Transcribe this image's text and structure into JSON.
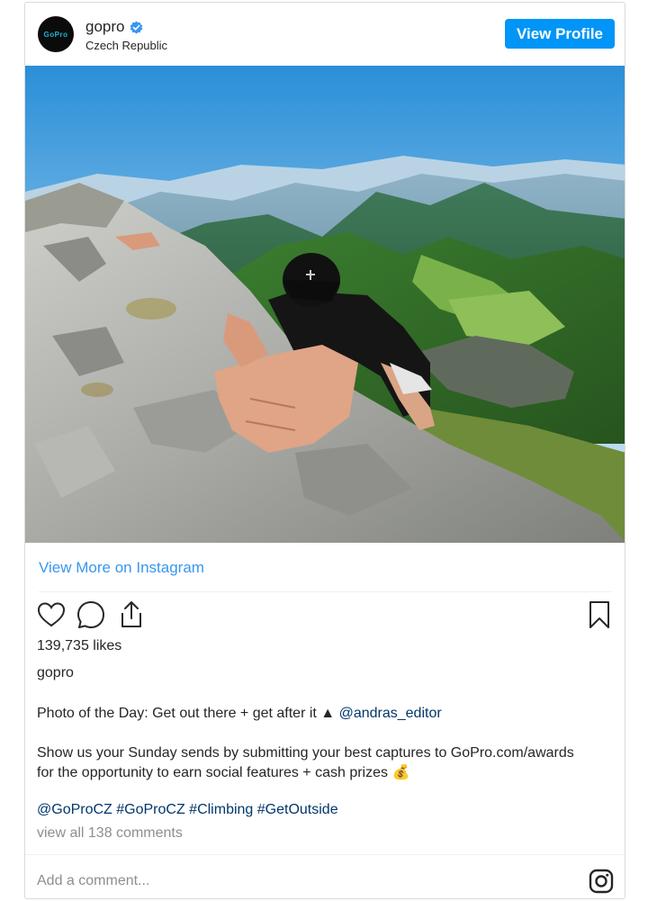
{
  "header": {
    "username": "gopro",
    "location": "Czech Republic",
    "avatar_text": "GoPro",
    "view_profile_label": "View Profile",
    "verified_icon": "verified-badge-icon",
    "accent_color": "#0095f6"
  },
  "post": {
    "image_alt": "climber-on-rock-mountain-view",
    "view_more_label": "View More on Instagram",
    "likes": "139,735 likes",
    "owner": "gopro",
    "caption": {
      "line1_text": "Photo of the Day: Get out there + get after it ",
      "line1_emoji": "▲",
      "line1_mention": "@andras_editor",
      "line2": "Show us your Sunday sends by submitting your best captures to GoPro.com/awards",
      "line3_text": "for the opportunity to earn social features + cash prizes ",
      "line3_emoji": "💰",
      "hashtags": "@GoProCZ #GoProCZ #Climbing #GetOutside"
    },
    "comments_link": "view all 138 comments",
    "add_comment_placeholder": "Add a comment..."
  },
  "icons": {
    "like": "heart-icon",
    "comment": "comment-bubble-icon",
    "share": "share-icon",
    "save": "bookmark-icon",
    "instagram": "instagram-logo-icon"
  }
}
